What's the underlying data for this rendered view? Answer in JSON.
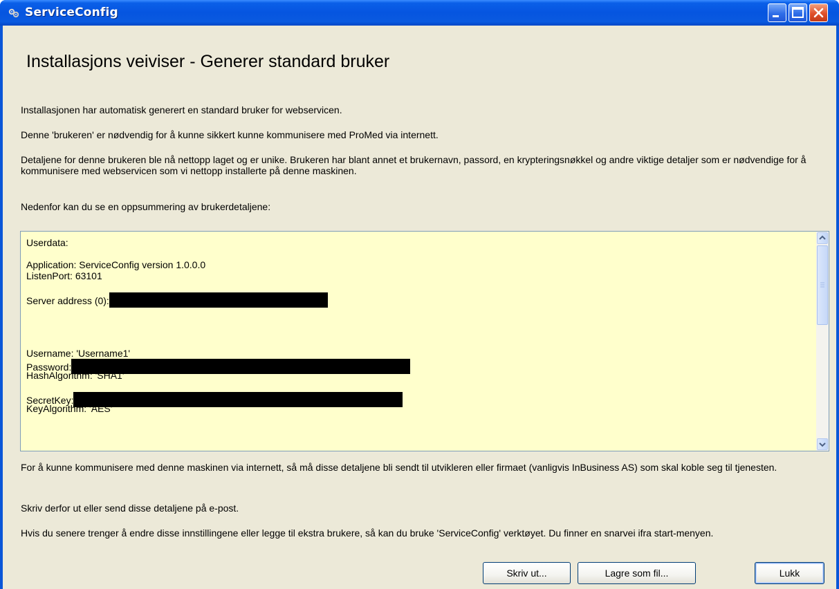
{
  "window": {
    "title": "ServiceConfig"
  },
  "heading": "Installasjons veiviser - Generer standard bruker",
  "intro": {
    "p1": "Installasjonen har automatisk generert en standard bruker for webservicen.",
    "p2": "Denne 'brukeren' er nødvendig for å kunne sikkert kunne kommunisere med ProMed via internett.",
    "p3": "Detaljene for denne brukeren ble nå nettopp laget og er unike. Brukeren har blant annet et brukernavn, passord, en krypteringsnøkkel og andre viktige detaljer som er nødvendige for å kommunisere med webservicen som vi nettopp installerte på denne maskinen.",
    "p4": "Nedenfor kan du se en oppsummering av brukerdetaljene:"
  },
  "userdata": {
    "header": "Userdata:",
    "application": "Application: ServiceConfig version 1.0.0.0",
    "listen_port": "ListenPort: 63101",
    "server_address_label": "Server address (0):",
    "username": "Username: 'Username1'",
    "password_label": "Password:",
    "hash_algorithm": "HashAlgorithm: 'SHA1'",
    "secret_key_label": "SecretKey:",
    "key_algorithm": "KeyAlgorithm: 'AES'"
  },
  "footer": {
    "p1": "For å kunne kommunisere med denne maskinen via internett, så må disse detaljene bli sendt til utvikleren eller firmaet (vanligvis InBusiness AS) som skal koble seg til tjenesten.",
    "p2": "Skriv derfor ut eller send disse detaljene på e-post.",
    "p3": "Hvis du senere trenger å endre disse innstillingene eller legge til ekstra brukere, så kan du bruke 'ServiceConfig' verktøyet. Du finner en snarvei ifra start-menyen."
  },
  "buttons": {
    "print": "Skriv ut...",
    "save": "Lagre som fil...",
    "close": "Lukk"
  },
  "colors": {
    "titlebar": "#0655e0",
    "dialog_bg": "#ece9d8",
    "textbox_bg": "#ffffcc",
    "close_button": "#e0502a"
  }
}
